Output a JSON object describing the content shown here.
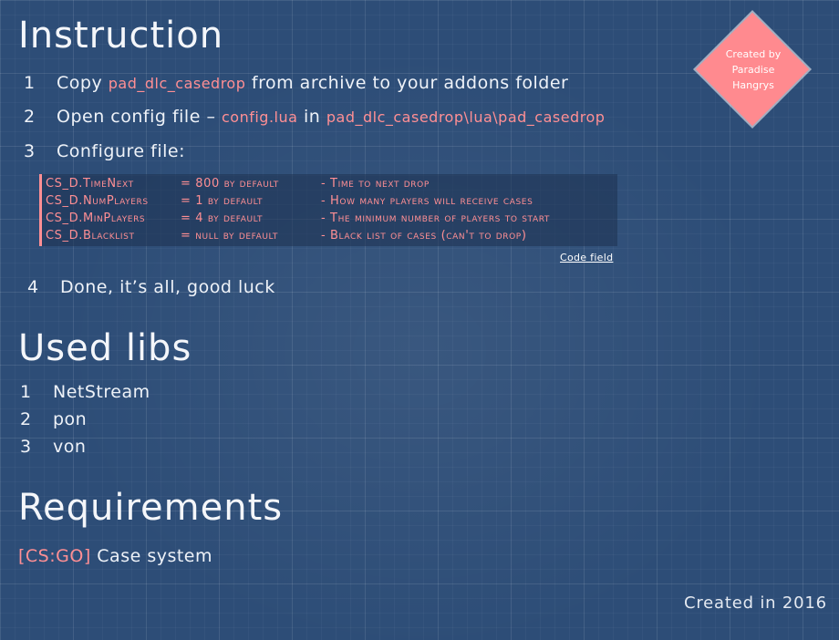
{
  "instruction": {
    "title": "Instruction",
    "steps": [
      {
        "num": "1",
        "text_before": "Copy",
        "code": "pad_dlc_casedrop",
        "text_after": "from archive to your addons folder"
      },
      {
        "num": "2",
        "text_before": "Open config file –",
        "code": "config.lua",
        "middle": "in",
        "code2": "pad_dlc_casedrop\\lua\\pad_casedrop"
      },
      {
        "num": "3",
        "text": "Configure file:"
      },
      {
        "num": "4",
        "text": "Done, it’s all, good luck"
      }
    ],
    "config_rows": [
      {
        "key": "CS_D.TimeNext",
        "value": "= 800 by default",
        "desc": "- Time to next drop"
      },
      {
        "key": "CS_D.NumPlayers",
        "value": "= 1 by default",
        "desc": "- How many players will receive cases"
      },
      {
        "key": "CS_D.MinPlayers",
        "value": "= 4 by default",
        "desc": "- The minimum number of players to start"
      },
      {
        "key": "CS_D.Blacklist",
        "value": "= null by default",
        "desc": "- Black list of cases (can't to drop)"
      }
    ],
    "code_field_label": "Code field"
  },
  "badge": {
    "line1": "Created by",
    "line2": "Paradise",
    "line3": "Hangrys"
  },
  "libs": {
    "title": "Used libs",
    "items": [
      {
        "num": "1",
        "name": "NetStream"
      },
      {
        "num": "2",
        "name": "pon"
      },
      {
        "num": "3",
        "name": "von"
      }
    ]
  },
  "requirements": {
    "title": "Requirements",
    "tag": "[CS:GO]",
    "name": "Case system"
  },
  "footer": "Created in 2016",
  "colors": {
    "accent": "#ff8f94",
    "background": "#2d4d77"
  }
}
